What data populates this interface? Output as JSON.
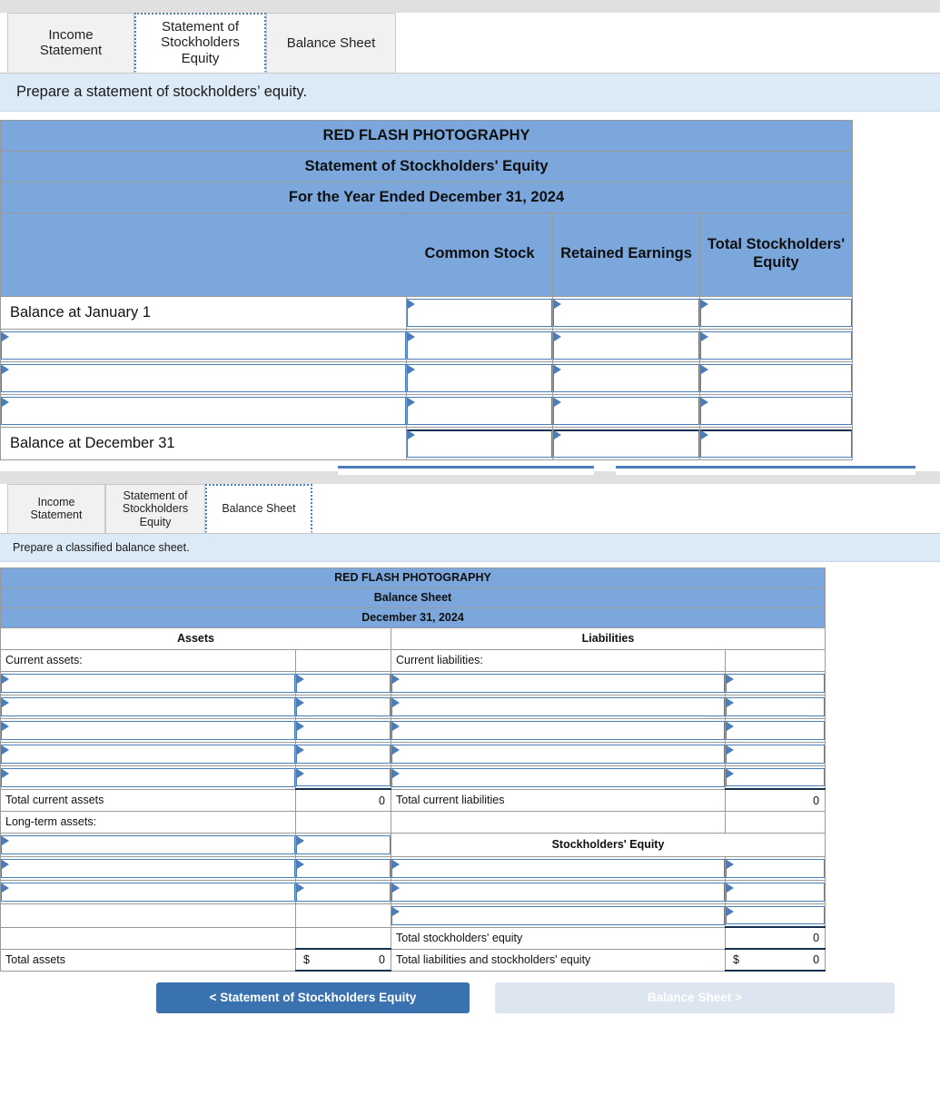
{
  "section1": {
    "tabs": [
      {
        "label": "Income\nStatement",
        "active": false
      },
      {
        "label": "Statement of\nStockholders\nEquity",
        "active": true
      },
      {
        "label": "Balance Sheet",
        "active": false
      }
    ],
    "instruction": "Prepare a statement of stockholders’ equity.",
    "statement": {
      "company": "RED FLASH PHOTOGRAPHY",
      "title": "Statement of Stockholders' Equity",
      "period": "For the Year Ended December 31, 2024",
      "columns": [
        "",
        "Common Stock",
        "Retained Earnings",
        "Total Stockholders' Equity"
      ],
      "rows": [
        {
          "label": "Balance at January 1",
          "label_input": false,
          "inputs": [
            true,
            true,
            true
          ]
        },
        {
          "label": "",
          "label_input": true,
          "inputs": [
            true,
            true,
            true
          ]
        },
        {
          "label": "",
          "label_input": true,
          "inputs": [
            true,
            true,
            true
          ]
        },
        {
          "label": "",
          "label_input": true,
          "inputs": [
            true,
            true,
            true
          ]
        },
        {
          "label": "Balance at December 31",
          "label_input": false,
          "inputs": [
            true,
            true,
            true
          ],
          "total": true
        }
      ]
    }
  },
  "section2": {
    "tabs": [
      {
        "label": "Income\nStatement",
        "active": false
      },
      {
        "label": "Statement of\nStockholders\nEquity",
        "active": false
      },
      {
        "label": "Balance Sheet",
        "active": true
      }
    ],
    "instruction": "Prepare a classified balance sheet.",
    "statement": {
      "company": "RED FLASH PHOTOGRAPHY",
      "title": "Balance Sheet",
      "period": "December 31, 2024",
      "left_header": "Assets",
      "right_header": "Liabilities",
      "equity_header": "Stockholders' Equity",
      "left": {
        "current_label": "Current assets:",
        "current_input_rows": 5,
        "total_current_label": "Total current assets",
        "total_current_value": "0",
        "longterm_label": "Long-term assets:",
        "longterm_input_rows": 3,
        "total_label": "Total assets",
        "total_currency": "$",
        "total_value": "0"
      },
      "right": {
        "current_label": "Current liabilities:",
        "current_input_rows": 5,
        "total_current_label": "Total current liabilities",
        "total_current_value": "0",
        "equity_input_rows": 3,
        "total_equity_label": "Total stockholders' equity",
        "total_equity_value": "0",
        "total_label": "Total liabilities and stockholders' equity",
        "total_currency": "$",
        "total_value": "0"
      }
    },
    "nav": {
      "prev_label": "< Statement of Stockholders Equity",
      "next_label": "Balance Sheet >"
    }
  }
}
